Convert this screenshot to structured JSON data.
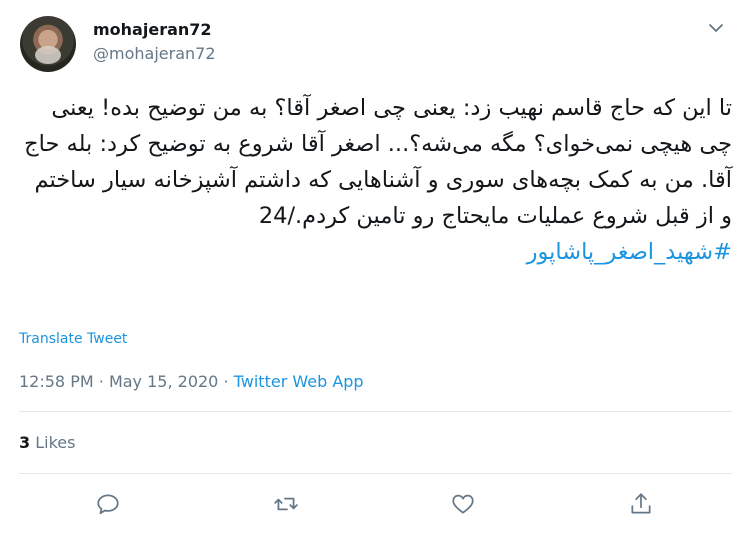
{
  "author": {
    "display_name": "mohajeran72",
    "handle": "@mohajeran72"
  },
  "tweet": {
    "text": "تا این که حاج قاسم نهیب زد: یعنی چی اصغر آقا؟ به من توضیح بده! یعنی چی هیچی نمی‌خوای؟ مگه می‌شه؟... اصغر آقا شروع به توضیح کرد: بله حاج آقا. من به کمک بچه‌های سوری و آشناهایی که داشتم آشپزخانه سیار ساختم و از قبل شروع عملیات مایحتاج رو تامین کردم./24",
    "hashtag": "#شهید_اصغر_پاشاپور"
  },
  "translate_label": "Translate Tweet",
  "meta": {
    "time": "12:58 PM",
    "separator1": "·",
    "date": "May 15, 2020",
    "separator2": "·",
    "source": "Twitter Web App"
  },
  "stats": {
    "likes_count": "3",
    "likes_label": "Likes"
  },
  "icons": {
    "caret": "chevron-down-icon",
    "reply": "reply-icon",
    "retweet": "retweet-icon",
    "like": "heart-icon",
    "share": "share-icon"
  },
  "colors": {
    "accent": "#1b95e0",
    "muted": "#657786",
    "text": "#14171a"
  }
}
